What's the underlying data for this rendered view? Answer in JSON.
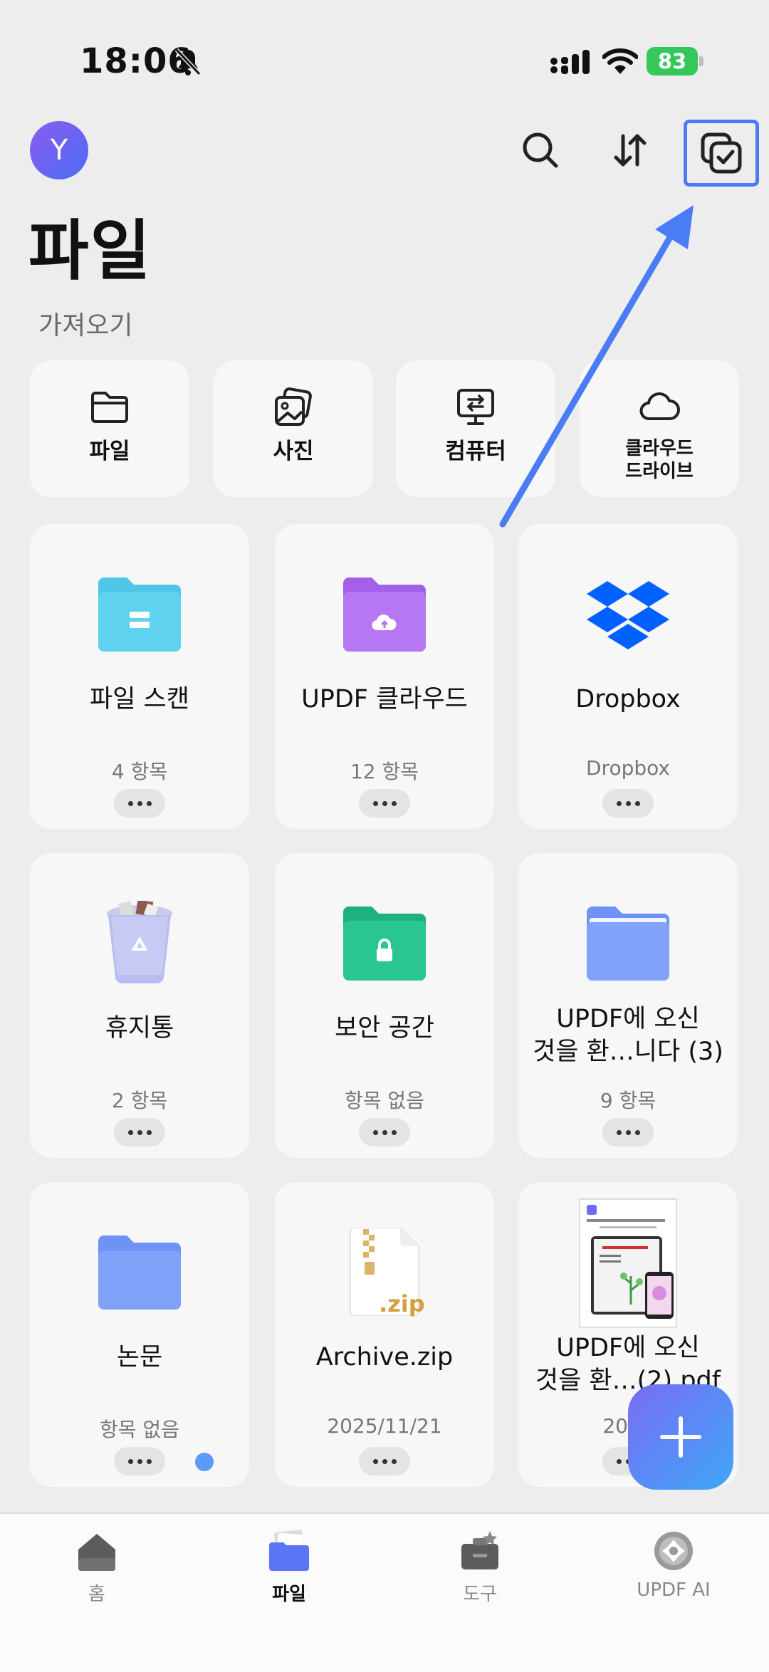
{
  "status_bar": {
    "time": "18:06",
    "battery": "83"
  },
  "header": {
    "avatar_letter": "Y",
    "title": "파일"
  },
  "import_section": {
    "label": "가져오기",
    "items": [
      {
        "label": "파일",
        "icon": "folder-outline-icon"
      },
      {
        "label": "사진",
        "icon": "photos-icon"
      },
      {
        "label": "컴퓨터",
        "icon": "computer-transfer-icon"
      },
      {
        "label": "클라우드\n드라이브",
        "icon": "cloud-icon"
      }
    ]
  },
  "files": [
    {
      "title": "파일 스캔",
      "sub": "4 항목",
      "icon": "scan-folder-icon"
    },
    {
      "title": "UPDF 클라우드",
      "sub": "12 항목",
      "icon": "cloud-folder-icon"
    },
    {
      "title": "Dropbox",
      "sub": "Dropbox",
      "icon": "dropbox-icon"
    },
    {
      "title": "휴지통",
      "sub": "2 항목",
      "icon": "trash-icon"
    },
    {
      "title": "보안 공간",
      "sub": "항목 없음",
      "icon": "secure-folder-icon"
    },
    {
      "title": "UPDF에 오신\n것을 환…니다 (3)",
      "sub": "9 항목",
      "icon": "folder-icon"
    },
    {
      "title": "논문",
      "sub": "항목 없음",
      "icon": "folder-icon"
    },
    {
      "title": "Archive.zip",
      "sub": "2025/11/21",
      "icon": "zip-file-icon"
    },
    {
      "title": "UPDF에 오신\n것을 환…(2).pdf",
      "sub": "2025",
      "icon": "pdf-thumbnail-icon"
    }
  ],
  "zip_label": ".zip",
  "tabs": [
    {
      "label": "홈",
      "icon": "home-icon"
    },
    {
      "label": "파일",
      "icon": "files-tab-icon"
    },
    {
      "label": "도구",
      "icon": "tools-icon"
    },
    {
      "label": "UPDF AI",
      "icon": "ai-icon"
    }
  ],
  "colors": {
    "accent": "#4a7cf6",
    "scan_folder": "#4fc6e8",
    "cloud_folder": "#b06ef0",
    "secure_folder": "#27c18d",
    "folder": "#7d9ff8",
    "dropbox": "#0061fe"
  }
}
